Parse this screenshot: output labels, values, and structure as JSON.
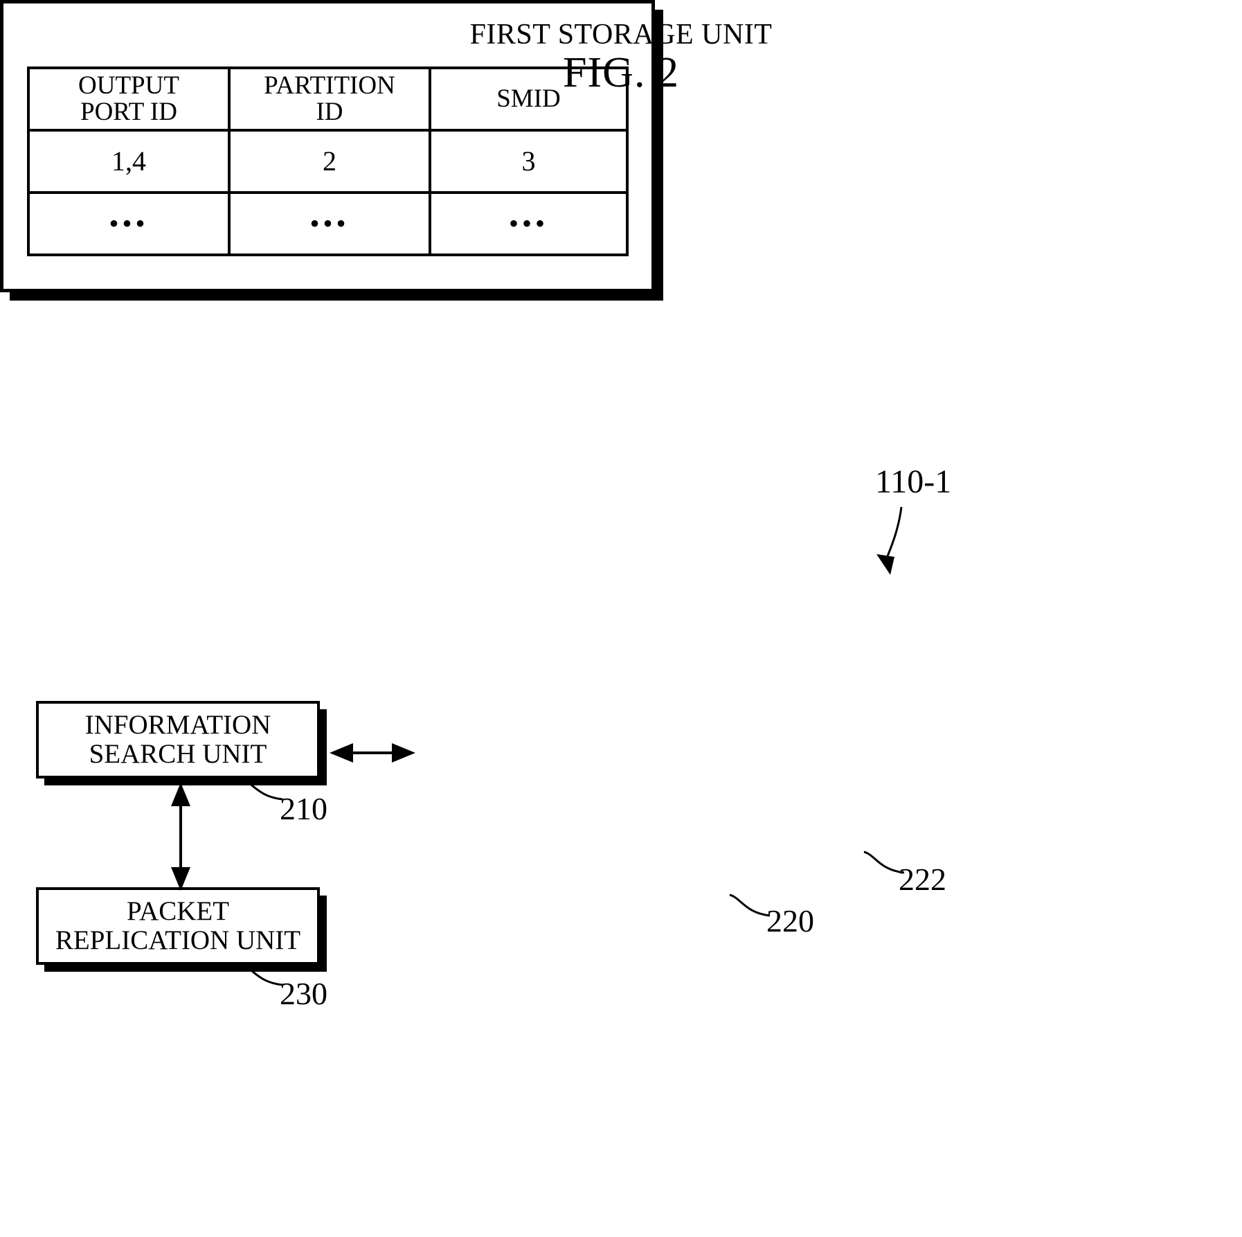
{
  "figure": {
    "title": "FIG. 2"
  },
  "blocks": {
    "information_search_unit": {
      "label_line1": "INFORMATION",
      "label_line2": "SEARCH UNIT",
      "ref": "210"
    },
    "packet_replication_unit": {
      "label_line1": "PACKET",
      "label_line2": "REPLICATION UNIT",
      "ref": "230"
    },
    "first_storage_unit": {
      "title": "FIRST STORAGE UNIT",
      "ref": "220",
      "table_ref": "222"
    },
    "system": {
      "ref": "110-1"
    }
  },
  "table": {
    "headers": [
      {
        "line1": "OUTPUT",
        "line2": "PORT ID"
      },
      {
        "line1": "PARTITION",
        "line2": "ID"
      },
      {
        "line1": "SMID",
        "line2": ""
      }
    ],
    "rows": [
      [
        "1,4",
        "2",
        "3"
      ],
      [
        "•••",
        "•••",
        "•••"
      ]
    ]
  },
  "connectors": {
    "search_to_storage": "bidirectional-horizontal-arrow",
    "search_to_replication": "bidirectional-vertical-arrow",
    "system_pointer": "curved-arrow-down-left"
  },
  "colors": {
    "ink": "#000000",
    "paper": "#ffffff"
  }
}
